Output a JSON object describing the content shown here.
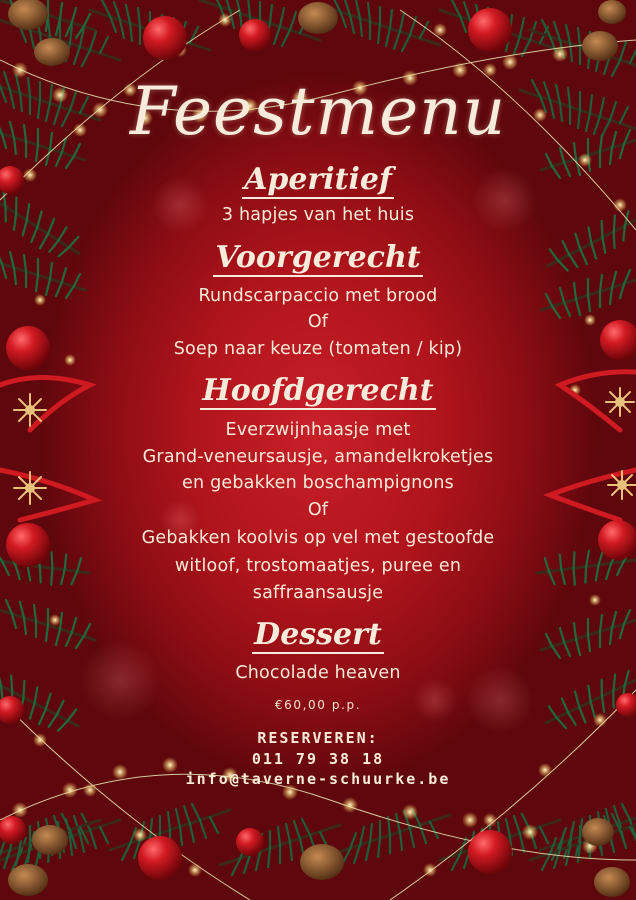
{
  "title": "Feestmenu",
  "courses": [
    {
      "heading": "Aperitief",
      "lines": [
        "3 hapjes van het huis"
      ]
    },
    {
      "heading": "Voorgerecht",
      "lines": [
        "Rundscarpaccio met brood",
        "Of",
        "Soep naar keuze (tomaten / kip)"
      ]
    },
    {
      "heading": "Hoofdgerecht",
      "lines": [
        "Everzwijnhaasje met",
        "Grand-veneursausje, amandelkroketjes",
        "en gebakken boschampignons",
        "Of",
        "Gebakken koolvis op vel met gestoofde",
        "witloof, trostomaatjes, puree en",
        "saffraansausje"
      ]
    },
    {
      "heading": "Dessert",
      "lines": [
        "Chocolade heaven"
      ]
    }
  ],
  "price": "€60,00 p.p.",
  "reservation": {
    "label": "RESERVEREN:",
    "phone": "011 79 38 18",
    "email": "info@taverne-schuurke.be"
  },
  "colors": {
    "background": "#b0141c",
    "text": "#f6ead8",
    "pine": "#1f5a36",
    "ornament": "#c8141e",
    "gold": "#e8c27a"
  },
  "decorations": [
    "pine-branch-icon",
    "ornament-ball-icon",
    "pine-cone-icon",
    "snowflake-icon",
    "string-lights-icon",
    "ribbon-bow-icon"
  ]
}
